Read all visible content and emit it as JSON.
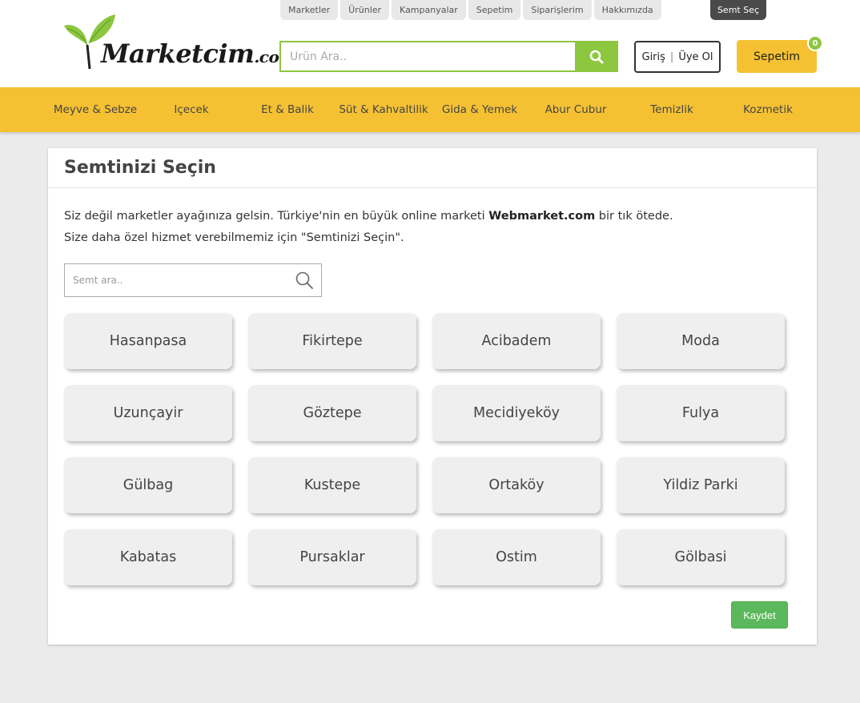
{
  "logo": {
    "text": "Marketcim",
    "suffix": ".com"
  },
  "topnav": [
    "Marketler",
    "Ürünler",
    "Kampanyalar",
    "Sepetim",
    "Siparişlerim",
    "Hakkımızda"
  ],
  "semt_sec_label": "Semt Seç",
  "search": {
    "placeholder": "Ürün Ara.."
  },
  "auth": {
    "login": "Giriş",
    "separator": "|",
    "register": "Üye Ol"
  },
  "cart": {
    "label": "Sepetim",
    "count": "0"
  },
  "categories": [
    "Meyve & Sebze",
    "Içecek",
    "Et & Balik",
    "Süt & Kahvaltilik",
    "Gida & Yemek",
    "Abur Cubur",
    "Temizlik",
    "Kozmetik"
  ],
  "panel": {
    "title": "Semtinizi Seçin",
    "intro_line1_before": "Siz değil marketler ayağınıza gelsin. Türkiye'nin en büyük online marketi ",
    "intro_brand": "Webmarket.com",
    "intro_line1_after": " bir tık ötede.",
    "intro_line2": "Size daha özel hizmet verebilmemiz için \"Semtinizi Seçin\".",
    "semt_search_placeholder": "Semt ara..",
    "districts": [
      "Hasanpasa",
      "Fikirtepe",
      "Acibadem",
      "Moda",
      "Uzunçayir",
      "Göztepe",
      "Mecidiyeköy",
      "Fulya",
      "Gülbag",
      "Kustepe",
      "Ortaköy",
      "Yildiz Parki",
      "Kabatas",
      "Pursaklar",
      "Ostim",
      "Gölbasi"
    ],
    "save_label": "Kaydet"
  },
  "colors": {
    "brand_green": "#8dc63f",
    "brand_yellow": "#f5c133",
    "save_green": "#5cb85c",
    "dark": "#4a4a4a"
  }
}
